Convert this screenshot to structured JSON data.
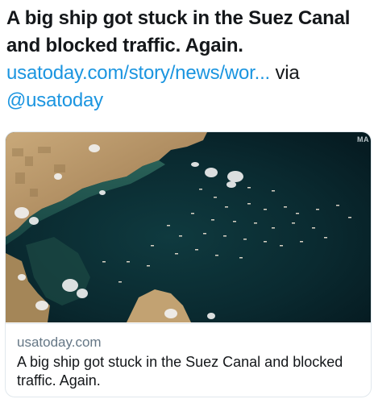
{
  "tweet": {
    "headline": "A big ship got stuck in the Suez Canal and blocked traffic. Again.",
    "link": "usatoday.com/story/news/wor...",
    "via": "via",
    "handle": "@usatoday"
  },
  "card": {
    "image_watermark": "MA",
    "domain": "usatoday.com",
    "title": "A big ship got stuck in the Suez Canal and blocked traffic. Again.",
    "colors": {
      "water": "#0b2f35",
      "land": "#b89868",
      "border": "#e1e8ed"
    }
  }
}
